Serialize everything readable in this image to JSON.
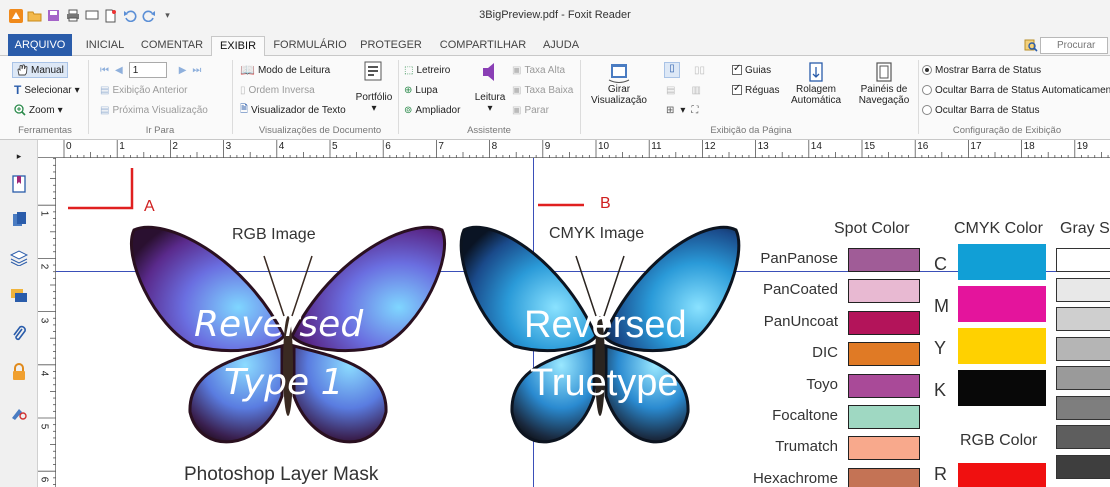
{
  "window": {
    "title": "3BigPreview.pdf - Foxit Reader"
  },
  "quick_access": [
    "foxit-logo-icon",
    "open-folder-icon",
    "save-icon",
    "print-icon",
    "screen-icon",
    "new-icon",
    "undo-icon",
    "redo-icon",
    "customize-icon"
  ],
  "tabs": [
    {
      "label": "ARQUIVO",
      "x": 0
    },
    {
      "label": "INICIAL"
    },
    {
      "label": "COMENTAR"
    },
    {
      "label": "EXIBIR"
    },
    {
      "label": "FORMULÁRIO"
    },
    {
      "label": "PROTEGER"
    },
    {
      "label": "COMPARTILHAR"
    },
    {
      "label": "AJUDA"
    }
  ],
  "search": {
    "placeholder": "Procurar"
  },
  "ribbon": {
    "tools": {
      "manual": "Manual",
      "select": "Selecionar",
      "zoom": "Zoom",
      "group": "Ferramentas"
    },
    "goto": {
      "prev_view": "Exibição Anterior",
      "next_view": "Próxima Visualização",
      "page": "1",
      "group": "Ir Para"
    },
    "docviews": {
      "reading": "Modo de Leitura",
      "reverse": "Ordem Inversa",
      "textviewer": "Visualizador de Texto",
      "portfolio": "Portfólio",
      "group": "Visualizações de Documento"
    },
    "assistant": {
      "marquee": "Letreiro",
      "loupe": "Lupa",
      "magnifier": "Ampliador",
      "read": "Leitura",
      "rate_high": "Taxa Alta",
      "rate_low": "Taxa Baixa",
      "stop": "Parar",
      "group": "Assistente"
    },
    "pagedisplay": {
      "rotate": "Girar Visualização",
      "guides": "Guias",
      "rulers": "Réguas",
      "autoscroll": "Rolagem Automática",
      "navpanels": "Painéis de Navegação",
      "group": "Exibição da Página"
    },
    "viewsettings": {
      "show_status": "Mostrar Barra de Status",
      "autohide_status": "Ocultar Barra de Status Automaticamente",
      "hide_status": "Ocultar Barra de Status",
      "group": "Configuração de Exibição"
    }
  },
  "ruler_numbers": [
    "0",
    "1",
    "2",
    "3",
    "4",
    "5",
    "6",
    "7",
    "8",
    "9",
    "10",
    "11",
    "12",
    "13",
    "14",
    "15",
    "16",
    "17",
    "18",
    "19"
  ],
  "ruler_left_numbers": [
    "1",
    "2",
    "3",
    "4",
    "5",
    "6"
  ],
  "document": {
    "marker_a": "A",
    "marker_b": "B",
    "rgb_image_label": "RGB Image",
    "cmyk_image_label": "CMYK Image",
    "butterfly1_line1": "Reversed",
    "butterfly1_line2": "Type 1",
    "butterfly2_line1": "Reversed",
    "butterfly2_line2": "Truetype",
    "photoshop_label": "Photoshop Layer Mask",
    "spot_header": "Spot Color",
    "cmyk_header": "CMYK Color",
    "gray_header": "Gray S",
    "rgb_header": "RGB Color",
    "spot_colors": [
      {
        "name": "PanPanose",
        "color": "#a05c97"
      },
      {
        "name": "PanCoated",
        "color": "#e8b9d2"
      },
      {
        "name": "PanUncoat",
        "color": "#b3145a"
      },
      {
        "name": "DIC",
        "color": "#e07a25"
      },
      {
        "name": "Toyo",
        "color": "#a94a98"
      },
      {
        "name": "Focaltone",
        "color": "#9fd8c2"
      },
      {
        "name": "Trumatch",
        "color": "#f8a98c"
      },
      {
        "name": "Hexachrome",
        "color": "#c47355"
      }
    ],
    "cmyk_colors": [
      {
        "letter": "C",
        "color": "#119fd6"
      },
      {
        "letter": "M",
        "color": "#e4149c"
      },
      {
        "letter": "Y",
        "color": "#ffd100"
      },
      {
        "letter": "K",
        "color": "#080808"
      }
    ],
    "rgb_letter": "R",
    "rgb_color": "#f01010",
    "gray_colors": [
      "#ffffff",
      "#e8e8e8",
      "#cfcfcf",
      "#b5b5b5",
      "#9a9a9a",
      "#7e7e7e",
      "#5e5e5e",
      "#3e3e3e"
    ]
  }
}
